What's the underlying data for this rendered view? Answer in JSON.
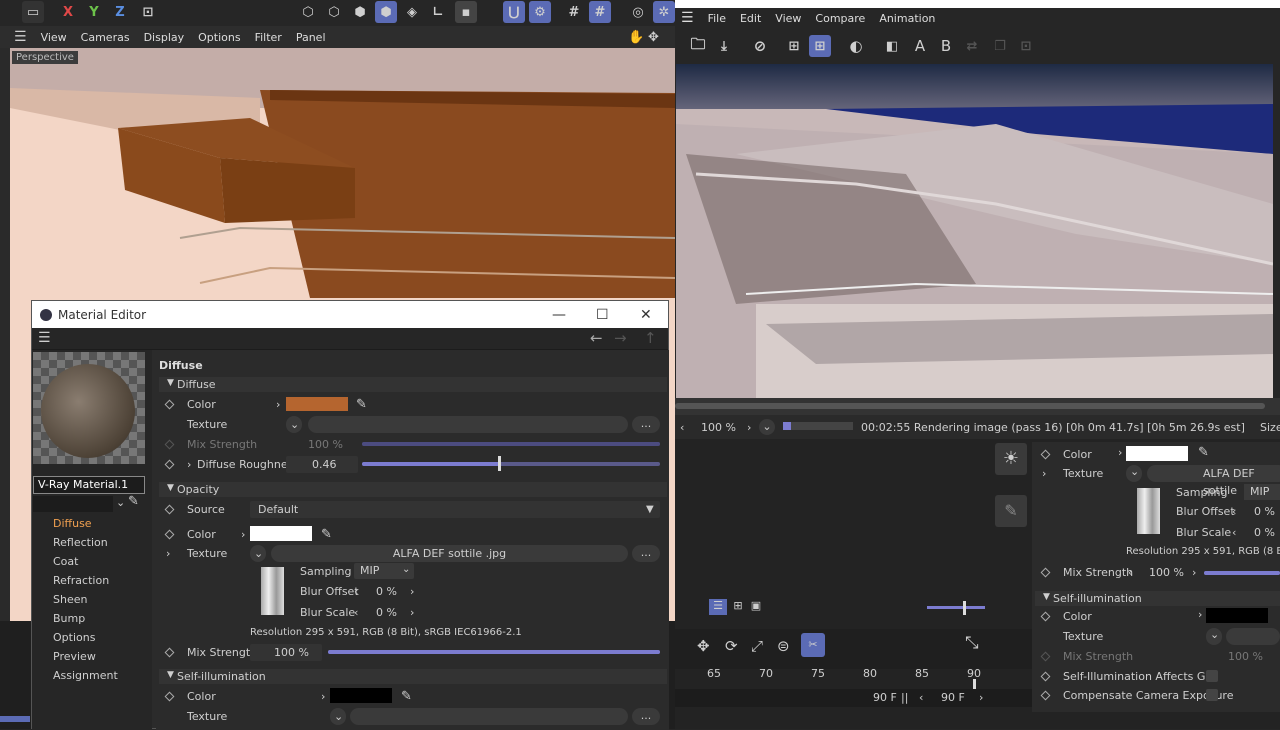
{
  "left_app": {
    "axes": {
      "x": "X",
      "y": "Y",
      "z": "Z"
    },
    "viewport_menu": [
      "View",
      "Cameras",
      "Display",
      "Options",
      "Filter",
      "Panel"
    ],
    "viewport_label": "Perspective"
  },
  "material_editor": {
    "title": "Material Editor",
    "material_name": "V-Ray Material.1",
    "nav": [
      "Diffuse",
      "Reflection",
      "Coat",
      "Refraction",
      "Sheen",
      "Bump",
      "Options",
      "Preview",
      "Assignment"
    ],
    "section_title": "Diffuse",
    "diffuse": {
      "group": "Diffuse",
      "color_label": "Color",
      "color_value": "#b5652f",
      "texture_label": "Texture",
      "mix_label": "Mix Strength",
      "mix_value": "100 %",
      "roughness_label": "Diffuse Roughness",
      "roughness_value": "0.46"
    },
    "opacity": {
      "group": "Opacity",
      "source_label": "Source",
      "source_value": "Default",
      "color_label": "Color",
      "texture_label": "Texture",
      "texture_value": "ALFA DEF sottile .jpg",
      "sampling_label": "Sampling",
      "sampling_value": "MIP",
      "blur_offset_label": "Blur Offset",
      "blur_offset_value": "0 %",
      "blur_scale_label": "Blur Scale",
      "blur_scale_value": "0 %",
      "resolution": "Resolution 295 x 591, RGB (8 Bit), sRGB IEC61966-2.1",
      "mix_label": "Mix Strength",
      "mix_value": "100 %"
    },
    "self_illum": {
      "group": "Self-illumination",
      "color_label": "Color",
      "texture_label": "Texture"
    },
    "more_btn": "..."
  },
  "right_app": {
    "menu": [
      "File",
      "Edit",
      "View",
      "Compare",
      "Animation"
    ],
    "tool_letters": {
      "a": "A",
      "b": "B"
    },
    "zoom": "100 %",
    "status": "00:02:55 Rendering image (pass 16) [0h  0m 41.7s] [0h  5m 26.9s est]",
    "size_label": "Size",
    "timeline": {
      "ticks": [
        "65",
        "70",
        "75",
        "80",
        "85",
        "90"
      ],
      "frame_a": "90 F",
      "frame_b": "90 F"
    },
    "props": {
      "color_label": "Color",
      "texture_label": "Texture",
      "texture_value": "ALFA DEF sottile",
      "sampling_label": "Sampling",
      "sampling_value": "MIP",
      "blur_offset_label": "Blur Offset",
      "blur_offset_value": "0 %",
      "blur_scale_label": "Blur Scale",
      "blur_scale_value": "0 %",
      "resolution": "Resolution 295 x 591, RGB (8 Bit), s",
      "mix_label": "Mix Strength",
      "mix_value": "100 %",
      "self_illum_group": "Self-illumination",
      "si_color_label": "Color",
      "si_texture_label": "Texture",
      "si_mix_label": "Mix Strength",
      "si_mix_value": "100 %",
      "si_affects_gi": "Self-Illumination Affects GI",
      "compensate": "Compensate Camera Exposure"
    }
  }
}
